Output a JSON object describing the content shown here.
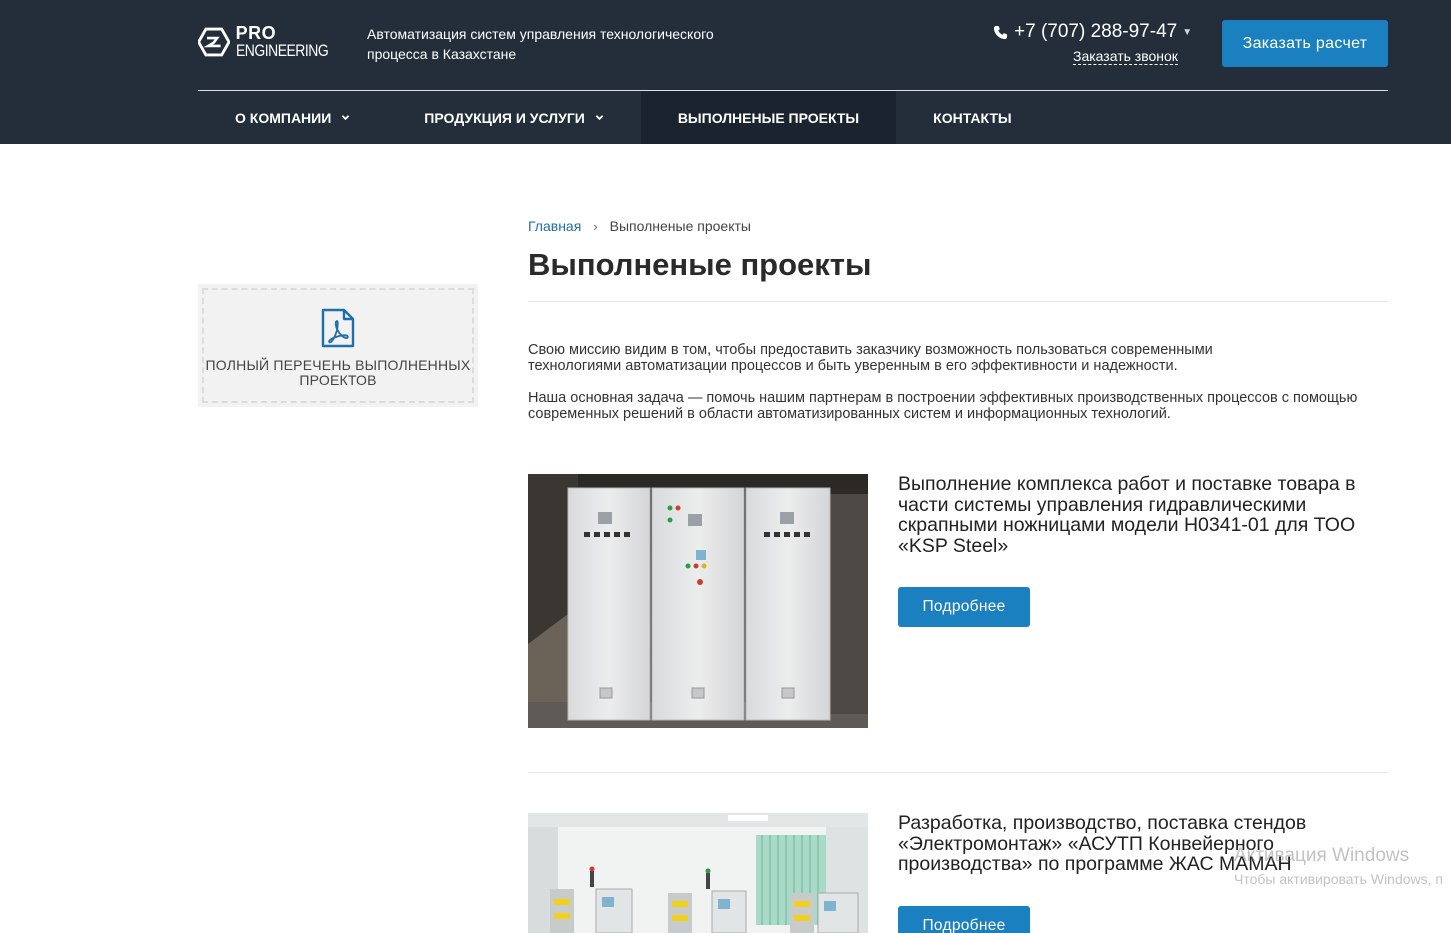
{
  "header": {
    "logo": {
      "line1": "PRO",
      "line2": "ENGINEERING"
    },
    "tagline": "Автоматизация систем управления технологического процесса в Казахстане",
    "phone": "+7 (707) 288-97-47",
    "callback_label": "Заказать звонок",
    "order_button": "Заказать расчет"
  },
  "nav": [
    {
      "label": "О КОМПАНИИ",
      "has_dropdown": true,
      "active": false
    },
    {
      "label": "ПРОДУКЦИЯ И УСЛУГИ",
      "has_dropdown": true,
      "active": false
    },
    {
      "label": "ВЫПОЛНЕНЫЕ ПРОЕКТЫ",
      "has_dropdown": false,
      "active": true
    },
    {
      "label": "КОНТАКТЫ",
      "has_dropdown": false,
      "active": false
    }
  ],
  "sidebar": {
    "pdf_label": "ПОЛНЫЙ ПЕРЕЧЕНЬ ВЫПОЛНЕННЫХ ПРОЕКТОВ"
  },
  "breadcrumb": {
    "home": "Главная",
    "separator": "›",
    "current": "Выполненые проекты"
  },
  "page_title": "Выполненые проекты",
  "intro": {
    "p1": "Свою миссию видим в том, чтобы предоставить заказчику возможность пользоваться современными технологиями автоматизации процессов и быть уверенным в его эффективности и надежности.",
    "p2": "Наша основная задача — помочь нашим партнерам в построении эффективных производственных процессов с помощью современных решений в области автоматизированных систем и информационных технологий."
  },
  "projects": [
    {
      "title": "Выполнение комплекса работ и поставке товара в части системы управления гидравлическими скрапными ножницами модели Н0341-01 для ТОО «KSP Steel»",
      "button": "Подробнее"
    },
    {
      "title": "Разработка, производство, поставка стендов «Электромонтаж» «АСУТП Конвейерного производства» по программе ЖАС МАМАН",
      "button": "Подробнее"
    }
  ],
  "watermark": {
    "line1": "Активация Windows",
    "line2": "Чтобы активировать Windows, п"
  },
  "colors": {
    "header_bg": "#232e3a",
    "nav_active_bg": "#1b242e",
    "accent": "#1a80c0",
    "link": "#1f6fa8"
  }
}
